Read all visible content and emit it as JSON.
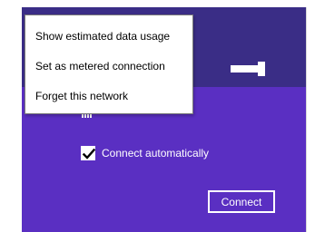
{
  "context_menu": {
    "items": [
      {
        "label": "Show estimated data usage"
      },
      {
        "label": "Set as metered connection"
      },
      {
        "label": "Forget this network"
      }
    ]
  },
  "network_panel": {
    "sharing_toggle": {
      "state": "on"
    },
    "connect_automatically": {
      "label": "Connect automatically",
      "checked": true
    },
    "connect_button": {
      "label": "Connect"
    }
  },
  "colors": {
    "panel_dark": "#3a2d86",
    "panel_accent": "#5a2fc2",
    "menu_bg": "#ffffff",
    "text_light": "#ffffff"
  },
  "icons": [
    "wifi-signal-icon",
    "checkmark-icon"
  ]
}
